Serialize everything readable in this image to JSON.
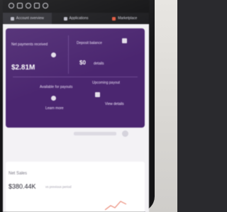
{
  "tabs": [
    {
      "label": "Account overview",
      "icon": "dashboard-icon"
    },
    {
      "label": "Applications",
      "icon": "apps-icon"
    },
    {
      "label": "Marketplace",
      "icon": "store-icon"
    }
  ],
  "card": {
    "net_payments_label": "Net payments received",
    "net_payments_value": "$2.81M",
    "deposit_label": "Deposit balance",
    "deposit_value": "$0",
    "deposit_sub": "details",
    "payouts_label": "Available for payouts",
    "payouts_link": "Learn more",
    "upcoming_label": "Upcoming payout",
    "upcoming_link": "View details"
  },
  "sales": {
    "label": "Net Sales",
    "value": "$380.44K",
    "sub": "vs previous period"
  },
  "colors": {
    "card_bg": "#4b2670",
    "accent": "#e2583e",
    "screen_bg": "#f3f2f5"
  }
}
